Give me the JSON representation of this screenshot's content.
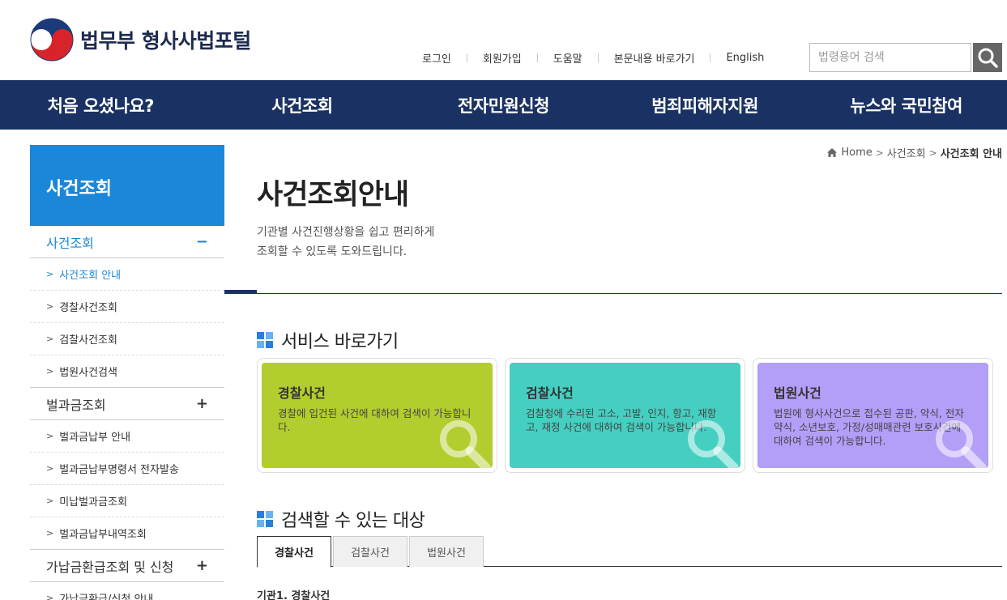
{
  "header": {
    "logo_text": "법무부 형사사법포털",
    "util_nav": [
      "로그인",
      "회원가입",
      "도움말",
      "본문내용 바로가기",
      "English"
    ],
    "search_placeholder": "법령용어 검색"
  },
  "gnb": [
    "처음 오셨나요?",
    "사건조회",
    "전자민원신청",
    "범죄피해자지원",
    "뉴스와 국민참여"
  ],
  "sidebar": {
    "title": "사건조회",
    "groups": [
      {
        "label": "사건조회",
        "toggle": "−",
        "items": [
          "사건조회 안내",
          "경찰사건조회",
          "검찰사건조회",
          "법원사건검색"
        ]
      },
      {
        "label": "벌과금조회",
        "toggle": "+",
        "items": [
          "벌과금납부 안내",
          "벌과금납부명령서 전자발송",
          "미납벌과금조회",
          "벌과금납부내역조회"
        ]
      },
      {
        "label": "가납금환급조회 및 신청",
        "toggle": "+",
        "items": [
          "가납금환급/신청 안내"
        ]
      }
    ]
  },
  "breadcrumb": {
    "home": "Home",
    "level1": "사건조회",
    "current": "사건조회 안내"
  },
  "main": {
    "title": "사건조회안내",
    "desc_line1": "기관별 사건진행상황을 쉽고 편리하게",
    "desc_line2": "조회할 수 있도록 도와드립니다.",
    "service_heading": "서비스 바로가기",
    "cards": [
      {
        "title": "경찰사건",
        "desc": "경찰에 입건된 사건에 대하여 검색이 가능합니다."
      },
      {
        "title": "검찰사건",
        "desc": "검찰청에 수리된 고소, 고발, 인지, 항고, 재항고, 재정 사건에 대하여 검색이 가능합니다."
      },
      {
        "title": "법원사건",
        "desc": "법원에 형사사건으로 접수된 공판, 약식, 전자약식, 소년보호, 가정/성매매관련 보호사건에 대하여 검색이 가능합니다."
      }
    ],
    "target_heading": "검색할 수 있는 대상",
    "tabs": [
      "경찰사건",
      "검찰사건",
      "법원사건"
    ],
    "sub_label": "기관1. 경찰사건"
  },
  "colors": {
    "navy": "#1a3263",
    "side_blue": "#1a87d9",
    "card_green": "#b2cd2e",
    "card_teal": "#45cfc1",
    "card_purple": "#b39ef8"
  }
}
